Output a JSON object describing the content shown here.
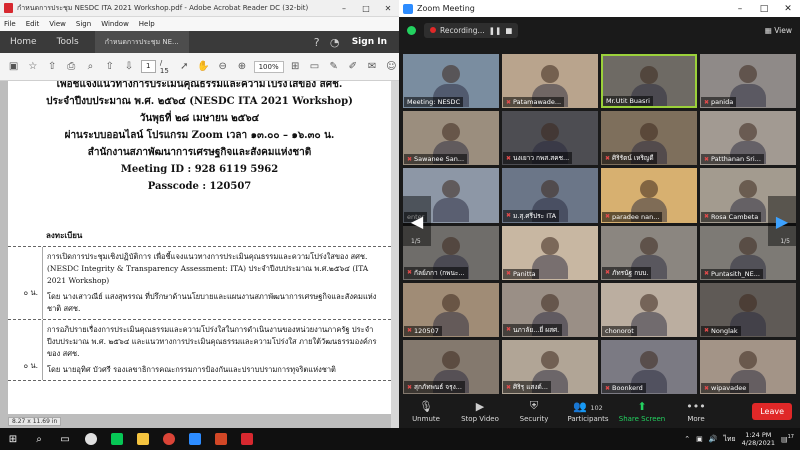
{
  "acrobat": {
    "title": "กำหนดการประชุม NESDC ITA 2021 Workshop.pdf - Adobe Acrobat Reader DC (32-bit)",
    "menu": [
      "File",
      "Edit",
      "View",
      "Sign",
      "Window",
      "Help"
    ],
    "tabs": {
      "home": "Home",
      "tools": "Tools",
      "doc": "กำหนดการประชุม NE..."
    },
    "sign_in": "Sign In",
    "toolbar": {
      "page_current": "1",
      "page_total": "/ 15",
      "zoom": "100%"
    },
    "status": "8.27 x 11.69 in",
    "page": {
      "line1": "เพื่อชี้แจงแนวทางการประเมินคุณธรรมและความโปร่งใสของ สศช.",
      "line2": "ประจำปีงบประมาณ พ.ศ. ๒๕๖๔ (NESDC ITA 2021 Workshop)",
      "line3": "วันพุธที่ ๒๘ เมษายน ๒๕๖๔",
      "line4": "ผ่านระบบออนไลน์ โปรแกรม Zoom เวลา ๑๓.๐๐ – ๑๖.๓๐ น.",
      "line5": "สำนักงานสภาพัฒนาการเศรษฐกิจและสังคมแห่งชาติ",
      "meeting_id": "Meeting ID : 928 6119 5962",
      "passcode": "Passcode : 120507",
      "agenda_title": "ลงทะเบียน",
      "rows": [
        {
          "time": "๐ น.",
          "p1": "การเปิดการประชุมเชิงปฏิบัติการ เพื่อชี้แจงแนวทางการประเมินคุณธรรมและความโปร่งใสของ สศช. (NESDC Integrity & Transparency Assessment: ITA) ประจำปีงบประมาณ พ.ศ.๒๕๖๔ (ITA 2021 Workshop)",
          "p2": "โดย นางเสาวณีย์ แสงสุพรรณ ที่ปรึกษาด้านนโยบายและแผนงานสภาพัฒนาการเศรษฐกิจและสังคมแห่งชาติ สศช."
        },
        {
          "time": "๐ น.",
          "p1": "การอภิปรายเรื่องการประเมินคุณธรรมและความโปร่งใสในการดำเนินงานของหน่วยงานภาครัฐ ประจำปีงบประมาณ พ.ศ. ๒๕๖๔ และแนวทางการประเมินคุณธรรมและความโปร่งใส ภายใต้วัฒนธรรมองค์กรของ สศช.",
          "p2": "โดย นายอุทิศ บัวศรี รองเลขาธิการคณะกรรมการป้องกันและปราบปรามการทุจริตแห่งชาติ"
        }
      ]
    }
  },
  "zoom": {
    "title": "Zoom Meeting",
    "recording": "Recording...",
    "view": "View",
    "page_left": "1/5",
    "page_right": "1/5",
    "participants_count": "102",
    "tiles": [
      {
        "name": "Meeting: NESDC",
        "bg": "#7a8da0",
        "muted": false,
        "active": false
      },
      {
        "name": "Patamawade...",
        "bg": "#b9a48d",
        "muted": true,
        "active": false
      },
      {
        "name": "Mr.Utit Buasri",
        "bg": "#6e6a64",
        "muted": false,
        "active": true
      },
      {
        "name": "panida",
        "bg": "#8f8a88",
        "muted": true,
        "active": false
      },
      {
        "name": "Sawanee San...",
        "bg": "#9b8e7e",
        "muted": true,
        "active": false
      },
      {
        "name": "นงเยาว กพส.สคช...",
        "bg": "#4d4d52",
        "muted": true,
        "active": false
      },
      {
        "name": "ศิริรัตน์ เหริญดี",
        "bg": "#7e6f5c",
        "muted": true,
        "active": false
      },
      {
        "name": "Patthanan Sri...",
        "bg": "#a29a92",
        "muted": true,
        "active": false
      },
      {
        "name": "enter",
        "bg": "#8d97a6",
        "muted": false,
        "active": false
      },
      {
        "name": "ม.สุ.ศรีประ ITA",
        "bg": "#6b7688",
        "muted": true,
        "active": false
      },
      {
        "name": "paradee nan...",
        "bg": "#d7b070",
        "muted": true,
        "active": false
      },
      {
        "name": "Rosa Cambeta",
        "bg": "#a39b8f",
        "muted": true,
        "active": false
      },
      {
        "name": "กัลย์ภกา (กพนะ...",
        "bg": "#6f6d6a",
        "muted": true,
        "active": false
      },
      {
        "name": "Panitta",
        "bg": "#c8b7a2",
        "muted": true,
        "active": false
      },
      {
        "name": "ภัทรนัฐ กบบ.",
        "bg": "#8b8680",
        "muted": true,
        "active": false
      },
      {
        "name": "Puntasith_NE...",
        "bg": "#7d7a75",
        "muted": true,
        "active": false
      },
      {
        "name": "120507",
        "bg": "#a08c76",
        "muted": true,
        "active": false
      },
      {
        "name": "นภาลัย...ยี่ ผสศ.",
        "bg": "#9a8f86",
        "muted": true,
        "active": false
      },
      {
        "name": "chonorot",
        "bg": "#bbaea0",
        "muted": false,
        "active": false
      },
      {
        "name": "Nonglak",
        "bg": "#5f5a56",
        "muted": true,
        "active": false
      },
      {
        "name": "สุกภัทพนธ์ จรุง...",
        "bg": "#84796e",
        "muted": true,
        "active": false
      },
      {
        "name": "ศิริรุ แสงต์...",
        "bg": "#b1a596",
        "muted": true,
        "active": false
      },
      {
        "name": "Boonkerd",
        "bg": "#7b7a83",
        "muted": true,
        "active": false
      },
      {
        "name": "wipavadee",
        "bg": "#a39487",
        "muted": true,
        "active": false
      }
    ],
    "controls": {
      "unmute": "Unmute",
      "stop_video": "Stop Video",
      "security": "Security",
      "participants": "Participants",
      "share": "Share Screen",
      "more": "More",
      "leave": "Leave"
    }
  },
  "taskbar": {
    "time": "1:24 PM",
    "date": "4/28/2021",
    "lang": "ไทย",
    "notif_count": "17"
  }
}
